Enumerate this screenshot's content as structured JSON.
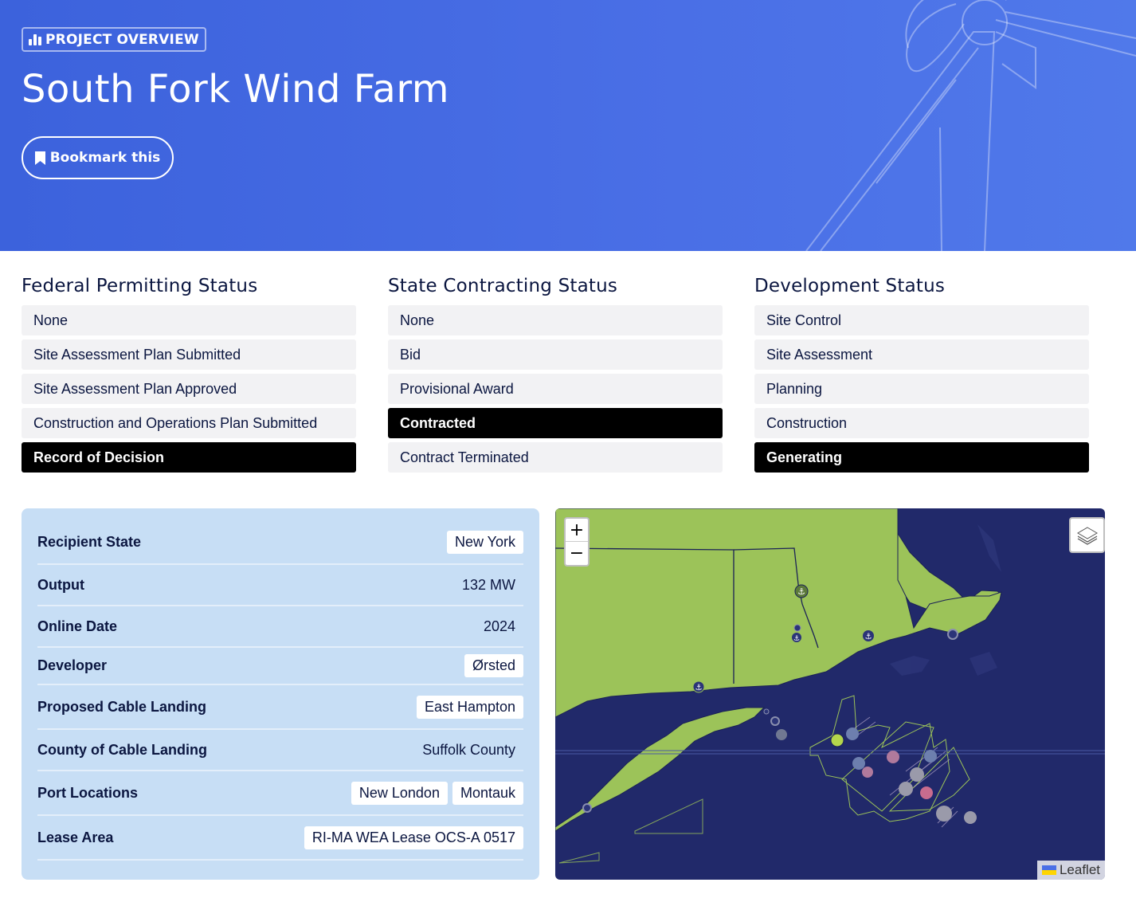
{
  "hero": {
    "eyebrow": "PROJECT OVERVIEW",
    "title": "South Fork Wind Farm",
    "bookmark_label": "Bookmark this"
  },
  "federal": {
    "heading": "Federal Permitting Status",
    "items": [
      {
        "label": "None",
        "active": false
      },
      {
        "label": "Site Assessment Plan Submitted",
        "active": false
      },
      {
        "label": "Site Assessment Plan Approved",
        "active": false
      },
      {
        "label": "Construction and Operations Plan Submitted",
        "active": false
      },
      {
        "label": "Record of Decision",
        "active": true
      }
    ]
  },
  "state": {
    "heading": "State Contracting Status",
    "items": [
      {
        "label": "None",
        "active": false
      },
      {
        "label": "Bid",
        "active": false
      },
      {
        "label": "Provisional Award",
        "active": false
      },
      {
        "label": "Contracted",
        "active": true
      },
      {
        "label": "Contract Terminated",
        "active": false
      }
    ]
  },
  "development": {
    "heading": "Development Status",
    "items": [
      {
        "label": "Site Control",
        "active": false
      },
      {
        "label": "Site Assessment",
        "active": false
      },
      {
        "label": "Planning",
        "active": false
      },
      {
        "label": "Construction",
        "active": false
      },
      {
        "label": "Generating",
        "active": true
      }
    ]
  },
  "info": {
    "rows": [
      {
        "label": "Recipient State",
        "values": [
          "New York"
        ],
        "chip": true
      },
      {
        "label": "Output",
        "values": [
          "132 MW"
        ],
        "chip": false
      },
      {
        "label": "Online Date",
        "values": [
          "2024"
        ],
        "chip": false
      },
      {
        "label": "Developer",
        "values": [
          "Ørsted"
        ],
        "chip": true
      },
      {
        "label": "Proposed Cable Landing",
        "values": [
          "East Hampton"
        ],
        "chip": true
      },
      {
        "label": "County of Cable Landing",
        "values": [
          "Suffolk County"
        ],
        "chip": false
      },
      {
        "label": "Port Locations",
        "values": [
          "New London",
          "Montauk"
        ],
        "chip": true
      },
      {
        "label": "Lease Area",
        "values": [
          "RI-MA WEA Lease OCS-A 0517"
        ],
        "chip": true
      }
    ]
  },
  "map": {
    "zoom_in": "+",
    "zoom_out": "−",
    "attribution": "Leaflet",
    "colors": {
      "water": "#21296a",
      "land": "#9cc359",
      "accent": "#4a6fe6"
    },
    "icons": [
      "anchor-icon",
      "turbine-icon",
      "layers-icon"
    ]
  }
}
